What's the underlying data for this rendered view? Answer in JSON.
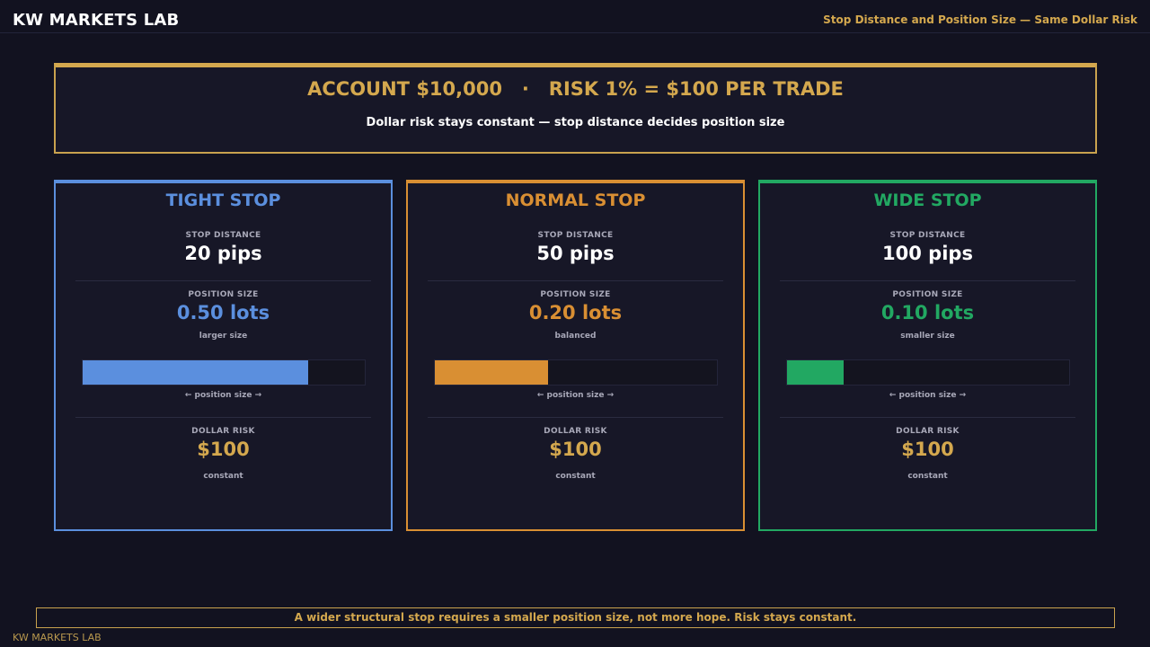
{
  "header": {
    "brand": "KW MARKETS LAB",
    "subtitle": "Stop Distance and Position Size — Same Dollar Risk"
  },
  "hero": {
    "title": "ACCOUNT $10,000   ·   RISK 1% = $100 PER TRADE",
    "subtitle": "Dollar risk stays constant — stop distance decides position size"
  },
  "colors": {
    "gold": "#d4a84e",
    "tight": "#5b8fde",
    "normal": "#d98f33",
    "wide": "#22a862"
  },
  "cards": [
    {
      "title": "TIGHT STOP",
      "color": "#5b8fde",
      "stop_label": "STOP DISTANCE",
      "stop_value": "20 pips",
      "size_label": "POSITION SIZE",
      "size_value": "0.50 lots",
      "size_note": "larger size",
      "bar_fraction": 0.8,
      "bar_caption": "← position size →",
      "risk_label": "DOLLAR RISK",
      "risk_value": "$100",
      "risk_note": "constant"
    },
    {
      "title": "NORMAL STOP",
      "color": "#d98f33",
      "stop_label": "STOP DISTANCE",
      "stop_value": "50 pips",
      "size_label": "POSITION SIZE",
      "size_value": "0.20 lots",
      "size_note": "balanced",
      "bar_fraction": 0.4,
      "bar_caption": "← position size →",
      "risk_label": "DOLLAR RISK",
      "risk_value": "$100",
      "risk_note": "constant"
    },
    {
      "title": "WIDE STOP",
      "color": "#22a862",
      "stop_label": "STOP DISTANCE",
      "stop_value": "100 pips",
      "size_label": "POSITION SIZE",
      "size_value": "0.10 lots",
      "size_note": "smaller size",
      "bar_fraction": 0.2,
      "bar_caption": "← position size →",
      "risk_label": "DOLLAR RISK",
      "risk_value": "$100",
      "risk_note": "constant"
    }
  ],
  "footer": {
    "note": "A wider structural stop requires a smaller position size, not more hope. Risk stays constant.",
    "brand": "KW MARKETS LAB"
  }
}
